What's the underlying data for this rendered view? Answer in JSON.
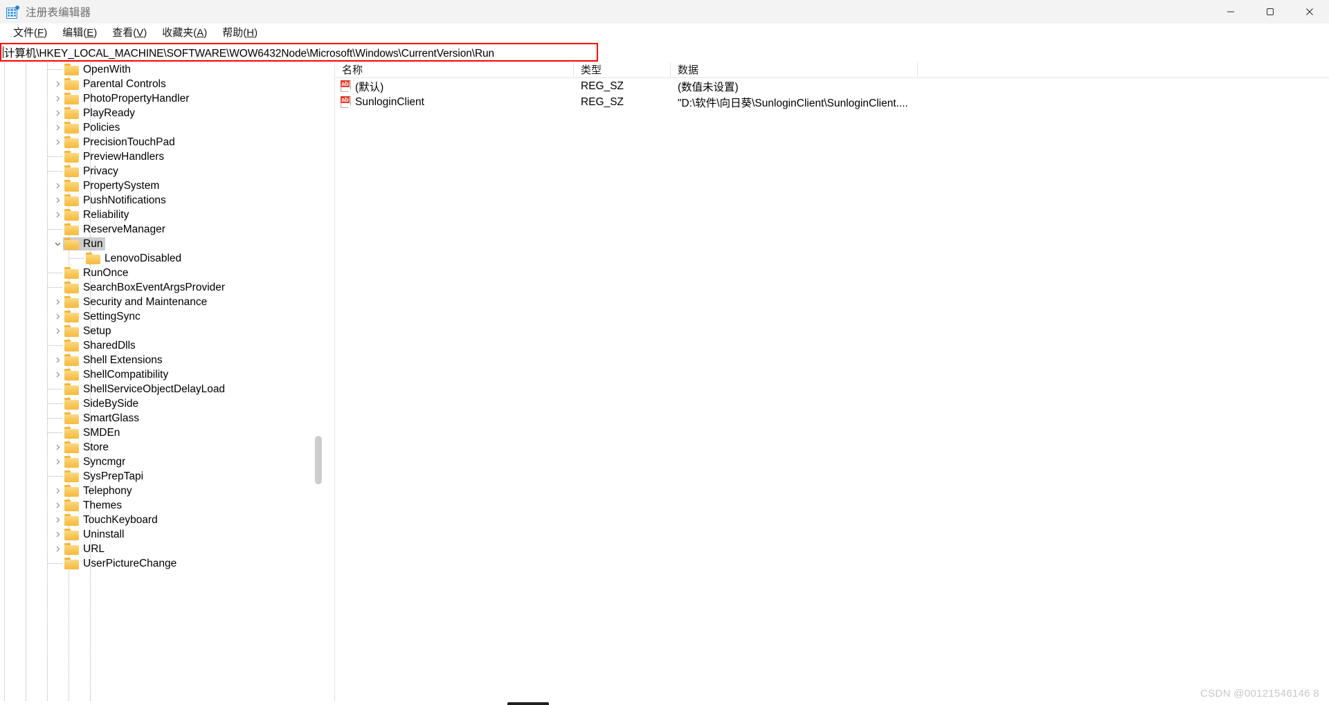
{
  "window": {
    "title": "注册表编辑器",
    "icon": "registry-editor-icon",
    "controls": {
      "minimize": "最小化",
      "maximize": "最大化",
      "close": "关闭"
    }
  },
  "menubar": {
    "items": [
      {
        "label": "文件",
        "accel": "F"
      },
      {
        "label": "编辑",
        "accel": "E"
      },
      {
        "label": "查看",
        "accel": "V"
      },
      {
        "label": "收藏夹",
        "accel": "A"
      },
      {
        "label": "帮助",
        "accel": "H"
      }
    ]
  },
  "address": {
    "value": "计算机\\HKEY_LOCAL_MACHINE\\SOFTWARE\\WOW6432Node\\Microsoft\\Windows\\CurrentVersion\\Run",
    "placeholder": "计算机\\",
    "highlight_color": "#ff0000"
  },
  "tree": {
    "selected": "Run",
    "nodes": [
      {
        "label": "OpenWith",
        "depth": 3,
        "expander": "none",
        "selected": false
      },
      {
        "label": "Parental Controls",
        "depth": 3,
        "expander": "collapsed",
        "selected": false
      },
      {
        "label": "PhotoPropertyHandler",
        "depth": 3,
        "expander": "collapsed",
        "selected": false
      },
      {
        "label": "PlayReady",
        "depth": 3,
        "expander": "collapsed",
        "selected": false
      },
      {
        "label": "Policies",
        "depth": 3,
        "expander": "collapsed",
        "selected": false
      },
      {
        "label": "PrecisionTouchPad",
        "depth": 3,
        "expander": "collapsed",
        "selected": false
      },
      {
        "label": "PreviewHandlers",
        "depth": 3,
        "expander": "none",
        "selected": false
      },
      {
        "label": "Privacy",
        "depth": 3,
        "expander": "none",
        "selected": false
      },
      {
        "label": "PropertySystem",
        "depth": 3,
        "expander": "collapsed",
        "selected": false
      },
      {
        "label": "PushNotifications",
        "depth": 3,
        "expander": "collapsed",
        "selected": false
      },
      {
        "label": "Reliability",
        "depth": 3,
        "expander": "collapsed",
        "selected": false
      },
      {
        "label": "ReserveManager",
        "depth": 3,
        "expander": "none",
        "selected": false
      },
      {
        "label": "Run",
        "depth": 3,
        "expander": "expanded",
        "selected": true
      },
      {
        "label": "LenovoDisabled",
        "depth": 4,
        "expander": "none",
        "selected": false
      },
      {
        "label": "RunOnce",
        "depth": 3,
        "expander": "none",
        "selected": false
      },
      {
        "label": "SearchBoxEventArgsProvider",
        "depth": 3,
        "expander": "none",
        "selected": false
      },
      {
        "label": "Security and Maintenance",
        "depth": 3,
        "expander": "collapsed",
        "selected": false
      },
      {
        "label": "SettingSync",
        "depth": 3,
        "expander": "collapsed",
        "selected": false
      },
      {
        "label": "Setup",
        "depth": 3,
        "expander": "collapsed",
        "selected": false
      },
      {
        "label": "SharedDlls",
        "depth": 3,
        "expander": "none",
        "selected": false
      },
      {
        "label": "Shell Extensions",
        "depth": 3,
        "expander": "collapsed",
        "selected": false
      },
      {
        "label": "ShellCompatibility",
        "depth": 3,
        "expander": "collapsed",
        "selected": false
      },
      {
        "label": "ShellServiceObjectDelayLoad",
        "depth": 3,
        "expander": "none",
        "selected": false
      },
      {
        "label": "SideBySide",
        "depth": 3,
        "expander": "none",
        "selected": false
      },
      {
        "label": "SmartGlass",
        "depth": 3,
        "expander": "none",
        "selected": false
      },
      {
        "label": "SMDEn",
        "depth": 3,
        "expander": "none",
        "selected": false
      },
      {
        "label": "Store",
        "depth": 3,
        "expander": "collapsed",
        "selected": false
      },
      {
        "label": "Syncmgr",
        "depth": 3,
        "expander": "collapsed",
        "selected": false
      },
      {
        "label": "SysPrepTapi",
        "depth": 3,
        "expander": "none",
        "selected": false
      },
      {
        "label": "Telephony",
        "depth": 3,
        "expander": "collapsed",
        "selected": false
      },
      {
        "label": "Themes",
        "depth": 3,
        "expander": "collapsed",
        "selected": false
      },
      {
        "label": "TouchKeyboard",
        "depth": 3,
        "expander": "collapsed",
        "selected": false
      },
      {
        "label": "Uninstall",
        "depth": 3,
        "expander": "collapsed",
        "selected": false
      },
      {
        "label": "URL",
        "depth": 3,
        "expander": "collapsed",
        "selected": false
      },
      {
        "label": "UserPictureChange",
        "depth": 3,
        "expander": "none",
        "selected": false
      }
    ]
  },
  "list": {
    "columns": [
      {
        "key": "name",
        "label": "名称"
      },
      {
        "key": "type",
        "label": "类型"
      },
      {
        "key": "data",
        "label": "数据"
      }
    ],
    "rows": [
      {
        "icon": "string-value-icon",
        "name": "(默认)",
        "type": "REG_SZ",
        "data": "(数值未设置)"
      },
      {
        "icon": "string-value-icon",
        "name": "SunloginClient",
        "type": "REG_SZ",
        "data": "\"D:\\软件\\向日葵\\SunloginClient\\SunloginClient...."
      }
    ]
  },
  "watermark": {
    "text": "CSDN @00121546146 8"
  }
}
